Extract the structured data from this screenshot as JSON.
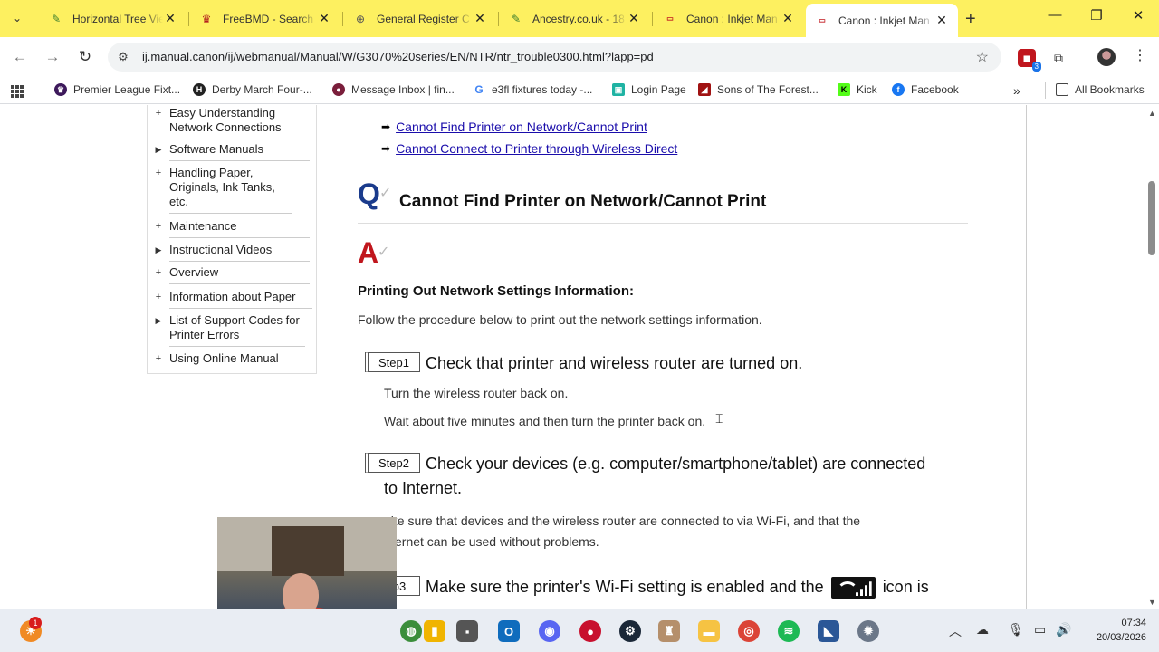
{
  "browser": {
    "tabs": [
      {
        "title": "Horizontal Tree Vie",
        "favicon": "leaf-icon",
        "color": "#3a7d2c"
      },
      {
        "title": "FreeBMD - Search",
        "favicon": "freebmd-icon",
        "color": "#b21e1e"
      },
      {
        "title": "General Register C",
        "favicon": "globe-icon",
        "color": "#555555"
      },
      {
        "title": "Ancestry.co.uk - 18",
        "favicon": "leaf-icon",
        "color": "#3a7d2c"
      },
      {
        "title": "Canon : Inkjet Man",
        "favicon": "canon-icon",
        "color": "#c0161d"
      },
      {
        "title": "Canon : Inkjet Man",
        "favicon": "canon-icon",
        "color": "#c0161d"
      }
    ],
    "active_tab": 5,
    "url": "ij.manual.canon/ij/webmanual/Manual/W/G3070%20series/EN/NTR/ntr_trouble0300.html?lapp=pd",
    "extension_badge": "3",
    "bookmarks": [
      {
        "label": "Premier League Fixt...",
        "icon": "premier-league-icon",
        "color": "#3d195b"
      },
      {
        "label": "Derby March Four-...",
        "icon": "h-icon",
        "color": "#222222"
      },
      {
        "label": "Message Inbox | fin...",
        "icon": "findmypast-icon",
        "color": "#7a1e3b"
      },
      {
        "label": "e3fl fixtures today -...",
        "icon": "google-icon",
        "color": "#4285f4"
      },
      {
        "label": "Login Page",
        "icon": "login-icon",
        "color": "#1fb3a3"
      },
      {
        "label": "Sons of The Forest...",
        "icon": "sons-forest-icon",
        "color": "#a01212"
      },
      {
        "label": "Kick",
        "icon": "kick-icon",
        "color": "#53fc18"
      },
      {
        "label": "Facebook",
        "icon": "facebook-icon",
        "color": "#1877f2"
      }
    ],
    "all_bookmarks": "All Bookmarks"
  },
  "sidebar": {
    "items": [
      {
        "marker": "+",
        "label": "Easy Understanding Network Connections"
      },
      {
        "marker": "▶",
        "label": "Software Manuals"
      },
      {
        "marker": "+",
        "label": "Handling Paper, Originals, Ink Tanks, etc."
      },
      {
        "marker": "+",
        "label": "Maintenance"
      },
      {
        "marker": "▶",
        "label": "Instructional Videos"
      },
      {
        "marker": "+",
        "label": "Overview"
      },
      {
        "marker": "+",
        "label": "Information about Paper"
      },
      {
        "marker": "▶",
        "label": "List of Support Codes for Printer Errors"
      },
      {
        "marker": "+",
        "label": "Using Online Manual"
      }
    ]
  },
  "content": {
    "links": [
      "Cannot Find Printer on Network/Cannot Print",
      "Cannot Connect to Printer through Wireless Direct"
    ],
    "q_letter": "Q",
    "question": "Cannot Find Printer on Network/Cannot Print",
    "a_letter": "A",
    "heading": "Printing Out Network Settings Information:",
    "intro": "Follow the procedure below to print out the network settings information.",
    "steps": [
      {
        "label": "Step1",
        "title": "Check that printer and wireless router are turned on.",
        "lines": [
          "Turn the wireless router back on.",
          "Wait about five minutes and then turn the printer back on."
        ]
      },
      {
        "label": "Step2",
        "title": "Check your devices (e.g. computer/smartphone/tablet) are connected",
        "title_cont": "to Internet.",
        "lines": [
          "ake sure that devices and the wireless router are connected to via Wi-Fi, and that the",
          "ernet can be used without problems."
        ]
      },
      {
        "label": "p3",
        "title_pre": "Make sure the printer's Wi-Fi setting is enabled and the",
        "title_post": "icon is"
      }
    ]
  },
  "taskbar": {
    "notification_count": "1",
    "time": "07:34",
    "date": "20/03/2026"
  }
}
